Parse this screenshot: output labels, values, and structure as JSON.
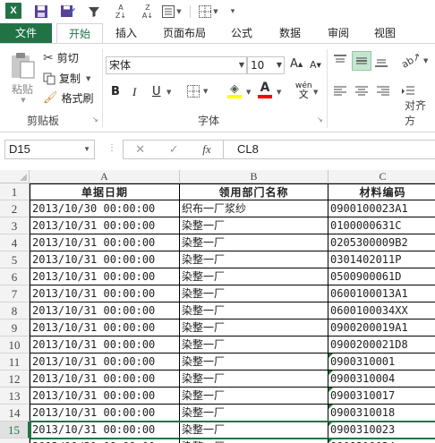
{
  "qat": {
    "app_icon_label": "X",
    "icons": [
      "save-icon",
      "save-as-icon",
      "filter-icon",
      "sort-ascending-icon",
      "sort-descending-icon",
      "form-icon",
      "borders-icon"
    ]
  },
  "tabs": {
    "file": "文件",
    "home": "开始",
    "insert": "插入",
    "page_layout": "页面布局",
    "formulas": "公式",
    "data": "数据",
    "review": "审阅",
    "view": "视图"
  },
  "ribbon": {
    "clipboard": {
      "paste": "粘贴",
      "cut": "剪切",
      "copy": "复制",
      "format_painter": "格式刷",
      "group_label": "剪贴板"
    },
    "font": {
      "font_name": "宋体",
      "font_size": "10",
      "bold": "B",
      "italic": "I",
      "underline": "U",
      "phonetic": "wén",
      "group_label": "字体"
    },
    "alignment": {
      "group_label": "对齐方"
    },
    "colors": {
      "fill": "#ffff00",
      "font_color": "#ff0000",
      "accent": "#217346"
    }
  },
  "formula_bar": {
    "name_box": "D15",
    "fx_label": "fx",
    "formula": "CL8"
  },
  "sheet": {
    "columns": [
      "A",
      "B",
      "C"
    ],
    "row_numbers": [
      "1",
      "2",
      "3",
      "4",
      "5",
      "6",
      "7",
      "8",
      "9",
      "10",
      "11",
      "12",
      "13",
      "14",
      "15",
      "16"
    ],
    "header": [
      "单据日期",
      "领用部门名称",
      "材料编码"
    ],
    "rows": [
      [
        "2013/10/30  00:00:00",
        "织布一厂浆纱",
        "0900100023A1"
      ],
      [
        "2013/10/31  00:00:00",
        "染整一厂",
        "0100000631C"
      ],
      [
        "2013/10/31  00:00:00",
        "染整一厂",
        "0205300009B2"
      ],
      [
        "2013/10/31  00:00:00",
        "染整一厂",
        "0301402011P"
      ],
      [
        "2013/10/31  00:00:00",
        "染整一厂",
        "0500900061D"
      ],
      [
        "2013/10/31  00:00:00",
        "染整一厂",
        "0600100013A1"
      ],
      [
        "2013/10/31  00:00:00",
        "染整一厂",
        "0600100034XX"
      ],
      [
        "2013/10/31  00:00:00",
        "染整一厂",
        "0900200019A1"
      ],
      [
        "2013/10/31  00:00:00",
        "染整一厂",
        "0900200021D8"
      ],
      [
        "2013/10/31  00:00:00",
        "染整一厂",
        "0900310001"
      ],
      [
        "2013/10/31  00:00:00",
        "染整一厂",
        "0900310004"
      ],
      [
        "2013/10/31  00:00:00",
        "染整一厂",
        "0900310017"
      ],
      [
        "2013/10/31  00:00:00",
        "染整一厂",
        "0900310018"
      ],
      [
        "2013/10/31  00:00:00",
        "染整一厂",
        "0900310023"
      ],
      [
        "2013/10/31  00:00:00",
        "染整一厂",
        "0900310024"
      ]
    ],
    "text_number_flag_rows": [
      11,
      12,
      13,
      14,
      15,
      16
    ],
    "selected_row": "15"
  }
}
